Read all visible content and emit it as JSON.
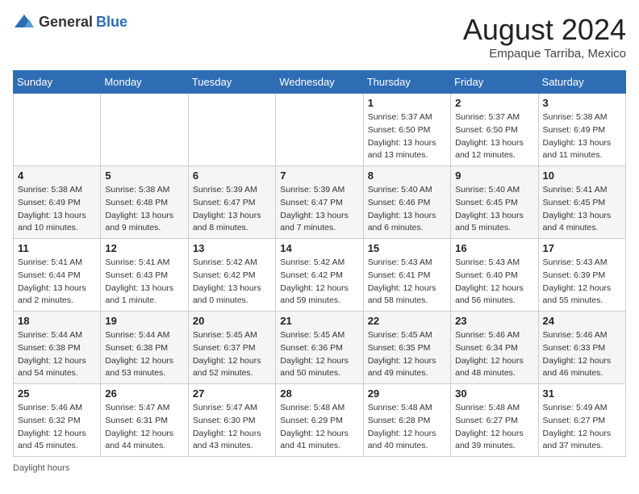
{
  "header": {
    "logo_general": "General",
    "logo_blue": "Blue",
    "month_year": "August 2024",
    "location": "Empaque Tarriba, Mexico"
  },
  "weekdays": [
    "Sunday",
    "Monday",
    "Tuesday",
    "Wednesday",
    "Thursday",
    "Friday",
    "Saturday"
  ],
  "weeks": [
    [
      {
        "day": "",
        "info": ""
      },
      {
        "day": "",
        "info": ""
      },
      {
        "day": "",
        "info": ""
      },
      {
        "day": "",
        "info": ""
      },
      {
        "day": "1",
        "info": "Sunrise: 5:37 AM\nSunset: 6:50 PM\nDaylight: 13 hours\nand 13 minutes."
      },
      {
        "day": "2",
        "info": "Sunrise: 5:37 AM\nSunset: 6:50 PM\nDaylight: 13 hours\nand 12 minutes."
      },
      {
        "day": "3",
        "info": "Sunrise: 5:38 AM\nSunset: 6:49 PM\nDaylight: 13 hours\nand 11 minutes."
      }
    ],
    [
      {
        "day": "4",
        "info": "Sunrise: 5:38 AM\nSunset: 6:49 PM\nDaylight: 13 hours\nand 10 minutes."
      },
      {
        "day": "5",
        "info": "Sunrise: 5:38 AM\nSunset: 6:48 PM\nDaylight: 13 hours\nand 9 minutes."
      },
      {
        "day": "6",
        "info": "Sunrise: 5:39 AM\nSunset: 6:47 PM\nDaylight: 13 hours\nand 8 minutes."
      },
      {
        "day": "7",
        "info": "Sunrise: 5:39 AM\nSunset: 6:47 PM\nDaylight: 13 hours\nand 7 minutes."
      },
      {
        "day": "8",
        "info": "Sunrise: 5:40 AM\nSunset: 6:46 PM\nDaylight: 13 hours\nand 6 minutes."
      },
      {
        "day": "9",
        "info": "Sunrise: 5:40 AM\nSunset: 6:45 PM\nDaylight: 13 hours\nand 5 minutes."
      },
      {
        "day": "10",
        "info": "Sunrise: 5:41 AM\nSunset: 6:45 PM\nDaylight: 13 hours\nand 4 minutes."
      }
    ],
    [
      {
        "day": "11",
        "info": "Sunrise: 5:41 AM\nSunset: 6:44 PM\nDaylight: 13 hours\nand 2 minutes."
      },
      {
        "day": "12",
        "info": "Sunrise: 5:41 AM\nSunset: 6:43 PM\nDaylight: 13 hours\nand 1 minute."
      },
      {
        "day": "13",
        "info": "Sunrise: 5:42 AM\nSunset: 6:42 PM\nDaylight: 13 hours\nand 0 minutes."
      },
      {
        "day": "14",
        "info": "Sunrise: 5:42 AM\nSunset: 6:42 PM\nDaylight: 12 hours\nand 59 minutes."
      },
      {
        "day": "15",
        "info": "Sunrise: 5:43 AM\nSunset: 6:41 PM\nDaylight: 12 hours\nand 58 minutes."
      },
      {
        "day": "16",
        "info": "Sunrise: 5:43 AM\nSunset: 6:40 PM\nDaylight: 12 hours\nand 56 minutes."
      },
      {
        "day": "17",
        "info": "Sunrise: 5:43 AM\nSunset: 6:39 PM\nDaylight: 12 hours\nand 55 minutes."
      }
    ],
    [
      {
        "day": "18",
        "info": "Sunrise: 5:44 AM\nSunset: 6:38 PM\nDaylight: 12 hours\nand 54 minutes."
      },
      {
        "day": "19",
        "info": "Sunrise: 5:44 AM\nSunset: 6:38 PM\nDaylight: 12 hours\nand 53 minutes."
      },
      {
        "day": "20",
        "info": "Sunrise: 5:45 AM\nSunset: 6:37 PM\nDaylight: 12 hours\nand 52 minutes."
      },
      {
        "day": "21",
        "info": "Sunrise: 5:45 AM\nSunset: 6:36 PM\nDaylight: 12 hours\nand 50 minutes."
      },
      {
        "day": "22",
        "info": "Sunrise: 5:45 AM\nSunset: 6:35 PM\nDaylight: 12 hours\nand 49 minutes."
      },
      {
        "day": "23",
        "info": "Sunrise: 5:46 AM\nSunset: 6:34 PM\nDaylight: 12 hours\nand 48 minutes."
      },
      {
        "day": "24",
        "info": "Sunrise: 5:46 AM\nSunset: 6:33 PM\nDaylight: 12 hours\nand 46 minutes."
      }
    ],
    [
      {
        "day": "25",
        "info": "Sunrise: 5:46 AM\nSunset: 6:32 PM\nDaylight: 12 hours\nand 45 minutes."
      },
      {
        "day": "26",
        "info": "Sunrise: 5:47 AM\nSunset: 6:31 PM\nDaylight: 12 hours\nand 44 minutes."
      },
      {
        "day": "27",
        "info": "Sunrise: 5:47 AM\nSunset: 6:30 PM\nDaylight: 12 hours\nand 43 minutes."
      },
      {
        "day": "28",
        "info": "Sunrise: 5:48 AM\nSunset: 6:29 PM\nDaylight: 12 hours\nand 41 minutes."
      },
      {
        "day": "29",
        "info": "Sunrise: 5:48 AM\nSunset: 6:28 PM\nDaylight: 12 hours\nand 40 minutes."
      },
      {
        "day": "30",
        "info": "Sunrise: 5:48 AM\nSunset: 6:27 PM\nDaylight: 12 hours\nand 39 minutes."
      },
      {
        "day": "31",
        "info": "Sunrise: 5:49 AM\nSunset: 6:27 PM\nDaylight: 12 hours\nand 37 minutes."
      }
    ]
  ],
  "legend": {
    "daylight_hours": "Daylight hours"
  }
}
